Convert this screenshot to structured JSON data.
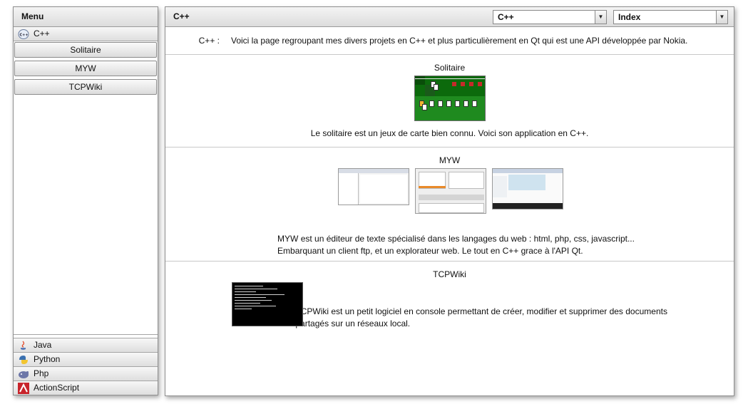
{
  "sidebar": {
    "title": "Menu",
    "sections": [
      {
        "label": "C++",
        "icon": "cpp-icon",
        "items": [
          {
            "label": "Solitaire"
          },
          {
            "label": "MYW"
          },
          {
            "label": "TCPWiki"
          }
        ]
      },
      {
        "label": "Java",
        "icon": "java-icon"
      },
      {
        "label": "Python",
        "icon": "python-icon"
      },
      {
        "label": "Php",
        "icon": "php-icon"
      },
      {
        "label": "ActionScript",
        "icon": "actionscript-icon"
      }
    ]
  },
  "main": {
    "title": "C++",
    "language_select": {
      "value": "C++"
    },
    "page_select": {
      "value": "Index"
    },
    "intro": {
      "label": "C++ :",
      "text": "Voici la page regroupant mes divers projets en C++ et plus particulièrement en Qt qui est une API développée par Nokia."
    },
    "projects": [
      {
        "title": "Solitaire",
        "description": "Le solitaire est un jeux de carte bien connu. Voici son application en C++."
      },
      {
        "title": "MYW",
        "description_line1": "MYW est un éditeur de texte spécialisé dans les langages du web : html, php, css, javascript...",
        "description_line2": "Embarquant un client ftp, et un explorateur web. Le tout en C++ grace à l'API Qt."
      },
      {
        "title": "TCPWiki",
        "description_line1": "TCPWiki est un petit logiciel en console permettant de créer, modifier et supprimer des documents",
        "description_line2": "partagés sur un réseaux local."
      }
    ]
  },
  "colors": {
    "header_gradient_top": "#f4f4f4",
    "header_gradient_bottom": "#dcdcdc",
    "border": "#8f8f8f",
    "solitaire_green": "#1f8a1f"
  }
}
